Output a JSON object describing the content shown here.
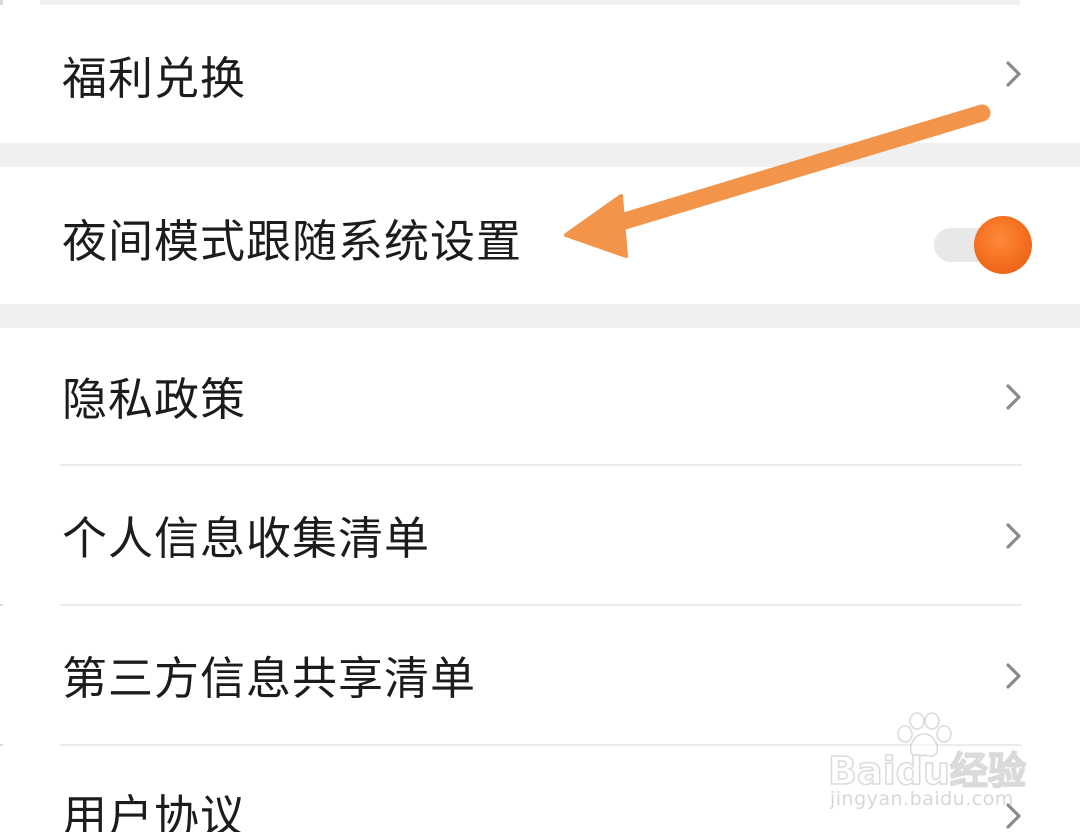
{
  "settings": {
    "items": [
      {
        "label": "福利兑换",
        "control": "chevron-right-icon"
      },
      {
        "label": "夜间模式跟随系统设置",
        "control": "toggle",
        "toggle_on": true
      },
      {
        "label": "隐私政策",
        "control": "chevron-right-icon"
      },
      {
        "label": "个人信息收集清单",
        "control": "chevron-right-icon"
      },
      {
        "label": "第三方信息共享清单",
        "control": "chevron-right-icon"
      },
      {
        "label": "用户协议",
        "control": "chevron-right-icon"
      }
    ]
  },
  "annotation": {
    "arrow_icon": "arrow-pointer-icon",
    "arrow_color": "#f2954a"
  },
  "watermark": {
    "brand": "Baidu",
    "brand_cn": "经验",
    "url": "jingyan.baidu.com",
    "icon": "paw-icon"
  },
  "colors": {
    "toggle_accent": "#f26b1d",
    "section_gap": "#f0f0f0"
  }
}
